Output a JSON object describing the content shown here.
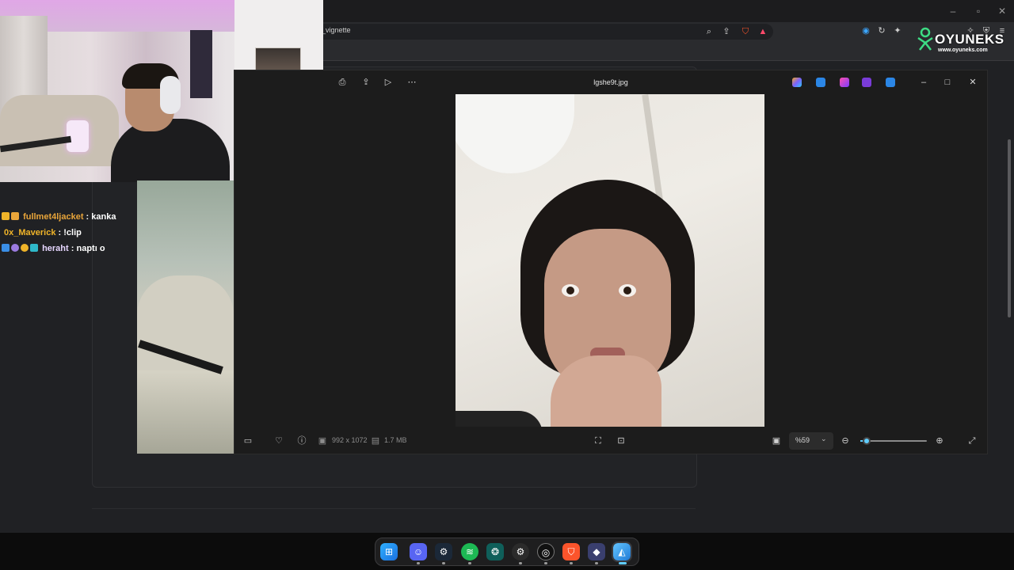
{
  "browser": {
    "url_fragment": "_vignette",
    "window_controls": [
      "minimize-icon",
      "maximize-icon",
      "close-icon"
    ]
  },
  "chat": [
    {
      "user": "fullmet4ljacket",
      "sep": ":",
      "message": "kanka",
      "user_color": "#e9a53a"
    },
    {
      "user": "0x_Maverick",
      "sep": ":",
      "message": "!clip",
      "user_color": "#f0b429"
    },
    {
      "user": "heraht",
      "sep": ":",
      "message": "naptı o",
      "user_color": "#e6d6ff"
    }
  ],
  "photos": {
    "filename": "lgshe9t.jpg",
    "dimensions": "992 x 1072",
    "file_size": "1.7 MB",
    "zoom_label": "%59",
    "zoom_level": 0.05
  },
  "overlay": {
    "brand": "OYUNEKS",
    "brand_url": "www.oyuneks.com"
  },
  "taskbar": {
    "apps": [
      "windows-start",
      "discord",
      "steam",
      "spotify",
      "app-wave",
      "obs-settings",
      "obs-studio",
      "brave",
      "app-diamond",
      "photos"
    ]
  },
  "colors": {
    "accent": "#60cdff",
    "chat_user": "#e9a53a",
    "window_bg": "#1c1c1c"
  }
}
